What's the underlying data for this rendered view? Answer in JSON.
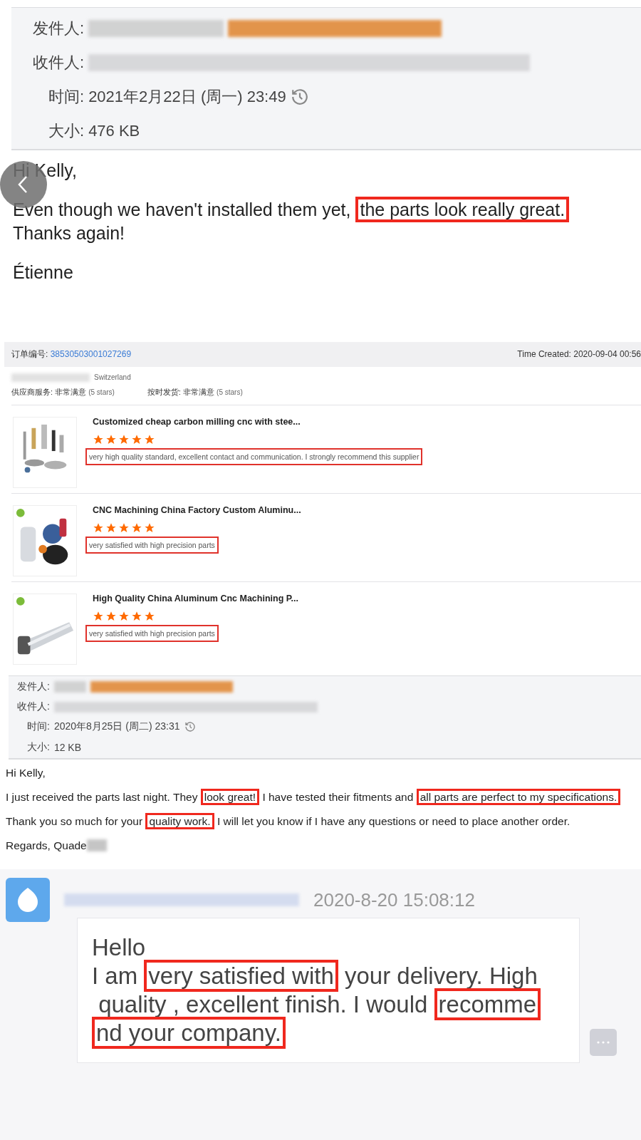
{
  "email_1": {
    "header": {
      "from_label": "发件人:",
      "to_label": "收件人:",
      "time_label": "时间:",
      "time": "2021年2月22日 (周一) 23:49",
      "size_label": "大小:",
      "size": "476 KB"
    },
    "paragraphs": [
      [
        [
          {
            "text": "Hi Kelly,",
            "highlighted": false
          }
        ]
      ],
      [
        [
          {
            "text": "Even though we haven't installed them yet, ",
            "highlighted": false
          },
          {
            "text": "the parts look really great.",
            "highlighted": true
          }
        ],
        [
          {
            "text": "Thanks again!",
            "highlighted": false
          }
        ]
      ],
      [
        [
          {
            "text": "Étienne",
            "highlighted": false
          }
        ]
      ]
    ]
  },
  "order_review": {
    "order_label": "订单编号:",
    "order_number": "38530503001027269",
    "time_created": "Time Created: 2020-09-04 00:56",
    "buyer_country": "Switzerland",
    "ratings": [
      {
        "label": "供应商服务:",
        "value": "非常满意",
        "stars_text": "(5 stars)"
      },
      {
        "label": "按时发货:",
        "value": "非常满意",
        "stars_text": "(5 stars)"
      }
    ],
    "products": [
      {
        "title": "Customized cheap carbon milling cnc with stee...",
        "stars": 5,
        "review": "very high quality standard, excellent contact and communication. I strongly recommend this supplier"
      },
      {
        "title": "CNC Machining China Factory Custom Aluminu...",
        "stars": 5,
        "review": "very satisfied with high precision parts"
      },
      {
        "title": "High Quality China Aluminum Cnc Machining P...",
        "stars": 5,
        "review": "very satisfied with high precision parts"
      }
    ]
  },
  "email_2": {
    "header": {
      "from_label": "发件人:",
      "to_label": "收件人:",
      "time_label": "时间:",
      "time": "2020年8月25日 (周二) 23:31",
      "size_label": "大小:",
      "size": "12 KB"
    },
    "paragraphs": [
      [
        [
          {
            "text": "Hi Kelly,",
            "highlighted": false
          }
        ]
      ],
      [
        [
          {
            "text": "I just received the parts last night. They ",
            "highlighted": false
          },
          {
            "text": "look great!",
            "highlighted": true
          },
          {
            "text": " I have tested their fitments and ",
            "highlighted": false
          },
          {
            "text": "all parts are perfect to my specifications.",
            "highlighted": true
          }
        ]
      ],
      [
        [
          {
            "text": "Thank you so much for your ",
            "highlighted": false
          },
          {
            "text": "quality work.",
            "highlighted": true
          },
          {
            "text": " I will let you know if I have any questions or need to place another order.",
            "highlighted": false
          }
        ]
      ],
      [
        [
          {
            "text": "Regards, Quade",
            "highlighted": false
          }
        ]
      ]
    ]
  },
  "chat": {
    "timestamp": "2020-8-20 15:08:12",
    "lines": [
      [
        {
          "text": "Hello",
          "highlighted": false
        }
      ],
      [
        {
          "text": "I am ",
          "highlighted": false
        },
        {
          "text": "very satisfied with",
          "highlighted": true
        },
        {
          "text": " your delivery. High",
          "highlighted": false
        }
      ],
      [
        {
          "text": " quality , excellent finish. I would ",
          "highlighted": false
        },
        {
          "text": "recomme",
          "highlighted": true
        }
      ],
      [
        {
          "text": "nd your company.",
          "highlighted": true
        }
      ]
    ]
  }
}
